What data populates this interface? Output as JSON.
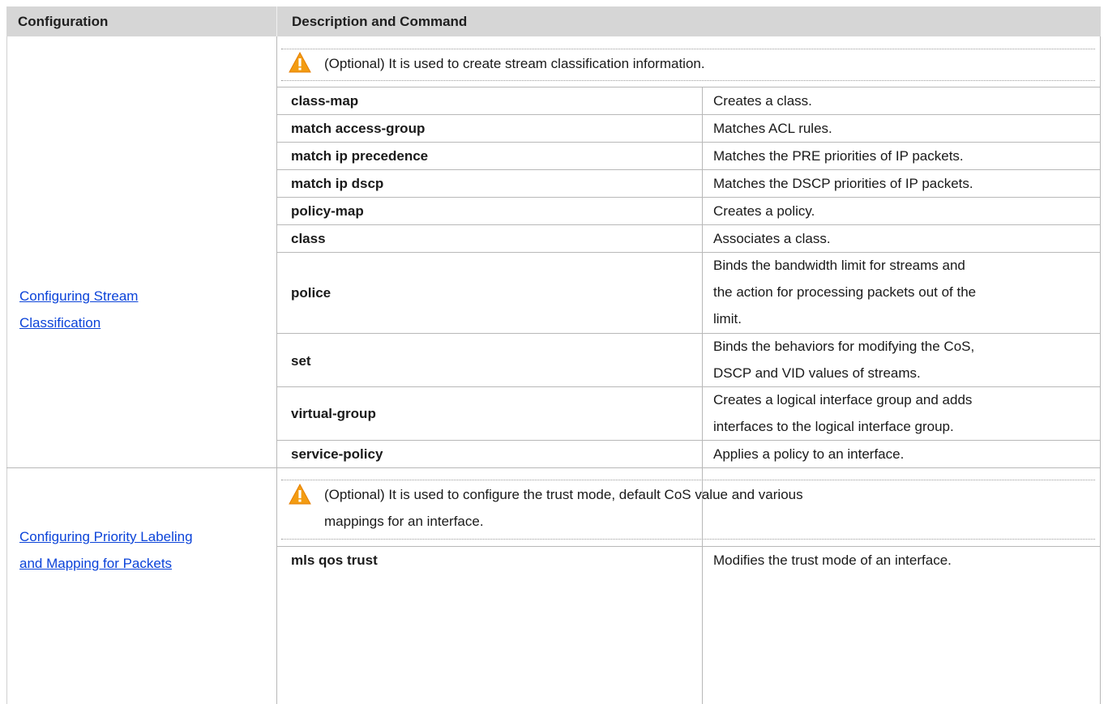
{
  "header": {
    "col1": "Configuration",
    "col2": "Description and Command"
  },
  "sections": [
    {
      "link_lines": [
        "Configuring Stream ",
        "Classification"
      ],
      "note": "(Optional) It is used to create stream classification information.",
      "rows": [
        {
          "command": "class-map",
          "description": [
            "Creates a class."
          ]
        },
        {
          "command": "match access-group",
          "description": [
            "Matches ACL rules."
          ]
        },
        {
          "command": "match ip precedence",
          "description": [
            "Matches the PRE priorities of IP packets."
          ]
        },
        {
          "command": "match ip dscp",
          "description": [
            "Matches the DSCP priorities of IP packets."
          ]
        },
        {
          "command": "policy-map",
          "description": [
            "Creates a policy."
          ]
        },
        {
          "command": "class",
          "description": [
            "Associates a class."
          ]
        },
        {
          "command": "police",
          "description": [
            "Binds the bandwidth limit for streams and",
            "the action for processing packets out of the",
            "limit."
          ]
        },
        {
          "command": "set",
          "description": [
            "Binds the behaviors for modifying the CoS,",
            "DSCP and VID values of streams."
          ]
        },
        {
          "command": "virtual-group",
          "description": [
            "Creates a logical interface group and adds",
            "interfaces to the logical interface group."
          ]
        },
        {
          "command": "service-policy",
          "description": [
            "Applies a policy to an interface."
          ]
        }
      ]
    },
    {
      "link_lines": [
        "Configuring Priority Labeling ",
        "and Mapping for Packets"
      ],
      "note_lines": [
        "(Optional) It is used to configure the trust mode, default CoS value and various",
        "mappings for an interface."
      ],
      "rows": [
        {
          "command": "mls qos trust",
          "description": [
            "Modifies the trust mode of an interface."
          ]
        }
      ]
    }
  ],
  "colors": {
    "header_bg": "#d6d6d6",
    "link": "#0b43d9",
    "warning": "#f39c12"
  }
}
